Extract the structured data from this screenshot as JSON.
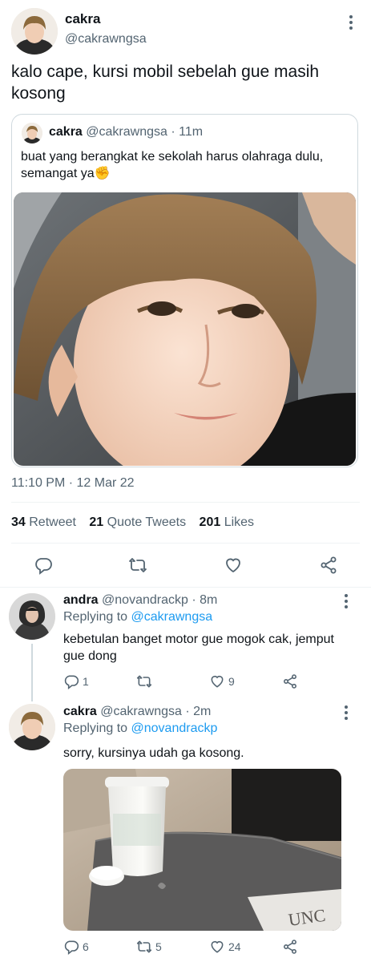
{
  "main_tweet": {
    "author_name": "cakra",
    "author_handle": "@cakrawngsa",
    "text": "kalo cape, kursi mobil sebelah gue masih kosong",
    "quoted": {
      "author_name": "cakra",
      "author_handle": "@cakrawngsa",
      "separator": "·",
      "time_ago": "11m",
      "text": "buat yang berangkat ke sekolah harus olahraga dulu, semangat ya✊"
    },
    "timestamp": "11:10 PM · 12 Mar 22",
    "stats": {
      "retweets_count": "34",
      "retweets_label": "Retweet",
      "quotes_count": "21",
      "quotes_label": "Quote Tweets",
      "likes_count": "201",
      "likes_label": "Likes"
    }
  },
  "replies": [
    {
      "author_name": "andra",
      "author_handle": "@novandrackp",
      "separator": "·",
      "time_ago": "8m",
      "replying_prefix": "Replying to",
      "replying_to": "@cakrawngsa",
      "text": "kebetulan banget motor gue mogok cak, jemput gue dong",
      "reply_count": "1",
      "retweet_count": "",
      "like_count": "9"
    },
    {
      "author_name": "cakra",
      "author_handle": "@cakrawngsa",
      "separator": "·",
      "time_ago": "2m",
      "replying_prefix": "Replying to",
      "replying_to": "@novandrackp",
      "text": "sorry, kursinya udah ga kosong.",
      "reply_count": "6",
      "retweet_count": "5",
      "like_count": "24"
    }
  ],
  "colors": {
    "accent": "#1d9bf0",
    "muted": "#536471",
    "text": "#0f1419",
    "divider": "#eff3f4"
  },
  "icons": [
    "reply-icon",
    "retweet-icon",
    "like-icon",
    "share-icon",
    "more-icon"
  ]
}
